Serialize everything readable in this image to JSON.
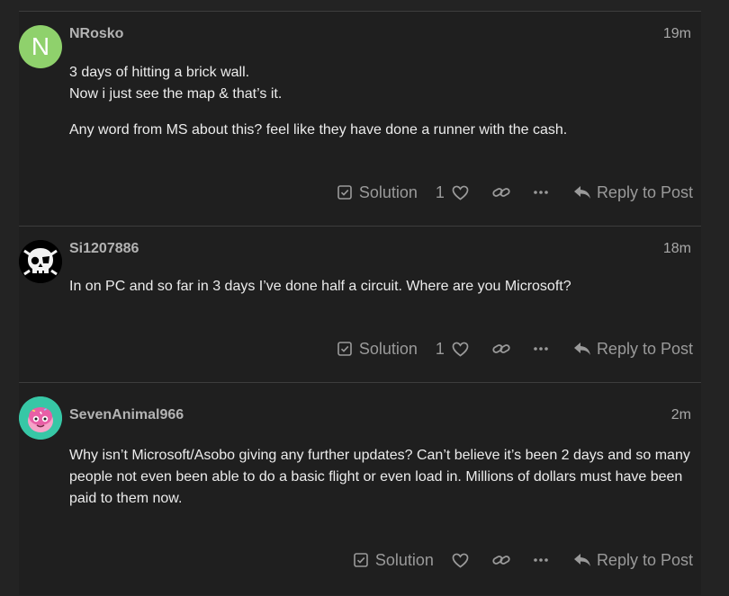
{
  "posts": [
    {
      "username": "NRosko",
      "age": "19m",
      "avatar_letter": "N",
      "paragraphs": [
        "3 days of hitting a brick wall.\nNow i just see the map & that’s it.",
        "Any word from MS about this? feel like they have done a runner with the cash."
      ],
      "solution_label": "Solution",
      "like_count": "1",
      "reply_label": "Reply to Post"
    },
    {
      "username": "Si1207886",
      "age": "18m",
      "avatar_icon": "skull-avatar",
      "paragraphs": [
        "In on PC and so far in 3 days I’ve done half a circuit. Where are you Microsoft?"
      ],
      "solution_label": "Solution",
      "like_count": "1",
      "reply_label": "Reply to Post"
    },
    {
      "username": "SevenAnimal966",
      "age": "2m",
      "avatar_icon": "donut-avatar",
      "paragraphs": [
        "Why isn’t Microsoft/Asobo giving any further updates? Can’t believe it’s been 2 days and so many people not even been able to do a basic flight or even load in. Millions of dollars must have been paid to them now."
      ],
      "solution_label": "Solution",
      "like_count": "",
      "reply_label": "Reply to Post"
    }
  ],
  "colors": {
    "page_bg": "#232323",
    "post_bg": "#1f1f1f",
    "divider": "#3d3d3d",
    "muted_text": "#9a9a9a",
    "avatar_green": "#8fd16c",
    "avatar_teal": "#37c7a6"
  }
}
